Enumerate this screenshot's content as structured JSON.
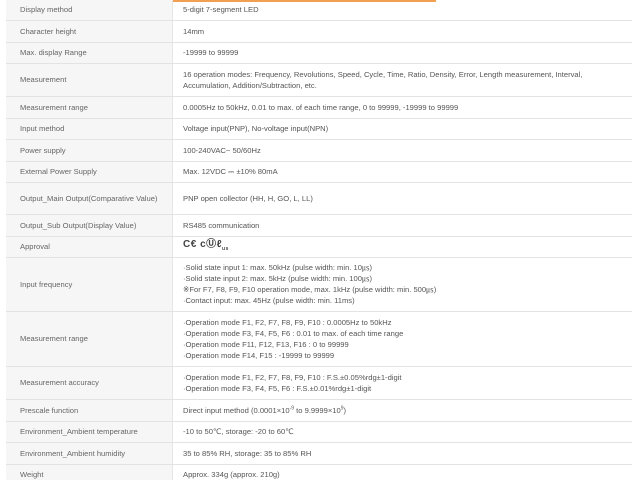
{
  "rows": [
    {
      "key": "Display method",
      "lines": [
        "5-digit 7-segment LED"
      ]
    },
    {
      "key": "Character height",
      "lines": [
        "14mm"
      ]
    },
    {
      "key": "Max. display Range",
      "lines": [
        "-19999 to 99999"
      ]
    },
    {
      "key": "Measurement",
      "lines": [
        "16 operation modes: Frequency, Revolutions, Speed, Cycle, Time, Ratio, Density, Error, Length measurement, Interval, Accumulation, Addition/Subtraction, etc."
      ]
    },
    {
      "key": "Measurement range",
      "lines": [
        "0.0005Hz to 50kHz, 0.01 to max. of each time range, 0 to 99999, -19999 to 99999"
      ]
    },
    {
      "key": "Input method",
      "lines": [
        "Voltage input(PNP), No-voltage input(NPN)"
      ]
    },
    {
      "key": "Power supply",
      "lines": [
        "100-240VAC~ 50/60Hz"
      ]
    },
    {
      "key": "External Power Supply",
      "lines": [
        "Max. 12VDC ⎓ ±10% 80mA"
      ]
    },
    {
      "key": "Output_Main Output(Comparative Value)",
      "lines": [
        "PNP open collector (HH, H, GO, L, LL)"
      ]
    },
    {
      "key": "Output_Sub Output(Display Value)",
      "lines": [
        "RS485 communication"
      ]
    },
    {
      "key": "Approval",
      "lines": []
    },
    {
      "key": "Input frequency",
      "lines": [
        "·Solid state input 1: max. 50kHz (pulse width: min. 10㎲)",
        "·Solid state input 2: max. 5kHz (pulse width: min. 100㎲)",
        "※For F7, F8, F9, F10 operation mode, max. 1kHz (pulse width: min. 500㎲)",
        "·Contact input: max. 45Hz (pulse width: min. 11ms)"
      ]
    },
    {
      "key": "Measurement range",
      "lines": [
        "·Operation mode F1, F2, F7, F8, F9, F10 : 0.0005Hz to 50kHz",
        "·Operation mode F3, F4, F5, F6 : 0.01 to max. of each time range",
        "·Operation mode F11, F12, F13, F16 : 0 to 99999",
        "·Operation mode F14, F15 : -19999 to 99999"
      ]
    },
    {
      "key": "Measurement accuracy",
      "lines": [
        "·Operation mode F1, F2, F7, F8, F9, F10 : F.S.±0.05%rdg±1-digit",
        "·Operation mode F3, F4, F5, F6 : F.S.±0.01%rdg±1-digit"
      ]
    },
    {
      "key": "Prescale function",
      "lines": []
    },
    {
      "key": "Environment_Ambient temperature",
      "lines": [
        "-10 to 50℃, storage: -20 to 60℃"
      ]
    },
    {
      "key": "Environment_Ambient humidity",
      "lines": [
        "35 to 85% RH, storage: 35 to 85% RH"
      ]
    },
    {
      "key": "Weight",
      "lines": [
        "Approx. 334g (approx. 210g)"
      ]
    }
  ],
  "approval": {
    "mark_ce": "C€",
    "mark_c": "c",
    "mark_ul": "Ⓤℓ",
    "mark_us": "us"
  },
  "prescale": {
    "prefix": "Direct input method (0.0001×10",
    "exp1": "-9",
    "mid": " to 9.9999×10",
    "exp2": "9",
    "suffix": ")"
  }
}
